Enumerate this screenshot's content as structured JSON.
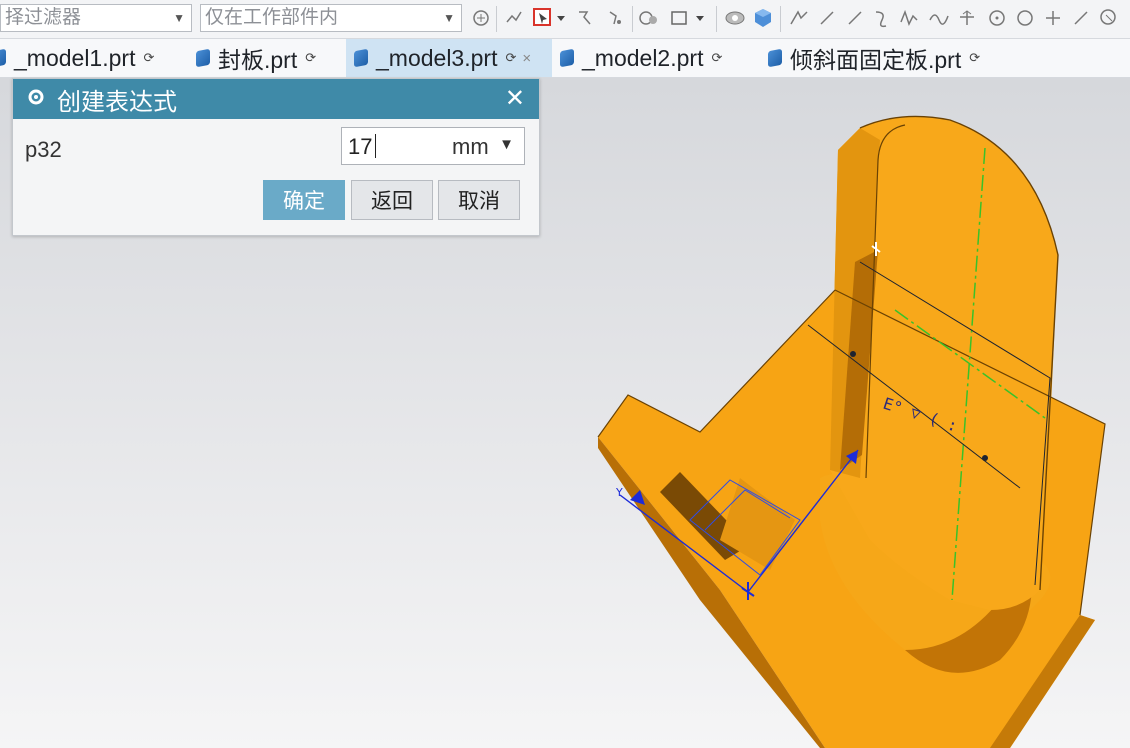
{
  "toolbar": {
    "filter_combo": "择过滤器",
    "scope_combo": "仅在工作部件内",
    "icons": [
      "snap-icon",
      "point-icon",
      "select-icon",
      "face-icon",
      "rectangle-icon",
      "view-icon",
      "shaded-cube-icon",
      "line-icon",
      "arc-icon",
      "curve-icon",
      "circle-icon",
      "plus-icon"
    ]
  },
  "tabs": [
    {
      "label": "_model1.prt",
      "active": false
    },
    {
      "label": "封板.prt",
      "active": false
    },
    {
      "label": "_model3.prt",
      "active": true
    },
    {
      "label": "_model2.prt",
      "active": false
    },
    {
      "label": "倾斜面固定板.prt",
      "active": false
    }
  ],
  "dialog": {
    "title": "创建表达式",
    "param_name": "p32",
    "value": "17",
    "unit": "mm",
    "ok_label": "确定",
    "back_label": "返回",
    "cancel_label": "取消"
  },
  "colors": {
    "dialog_title_bg": "#3f8aa8",
    "part_orange": "#f5a30c",
    "active_tab": "#cfe3f3",
    "primary_button": "#6aaac8"
  }
}
